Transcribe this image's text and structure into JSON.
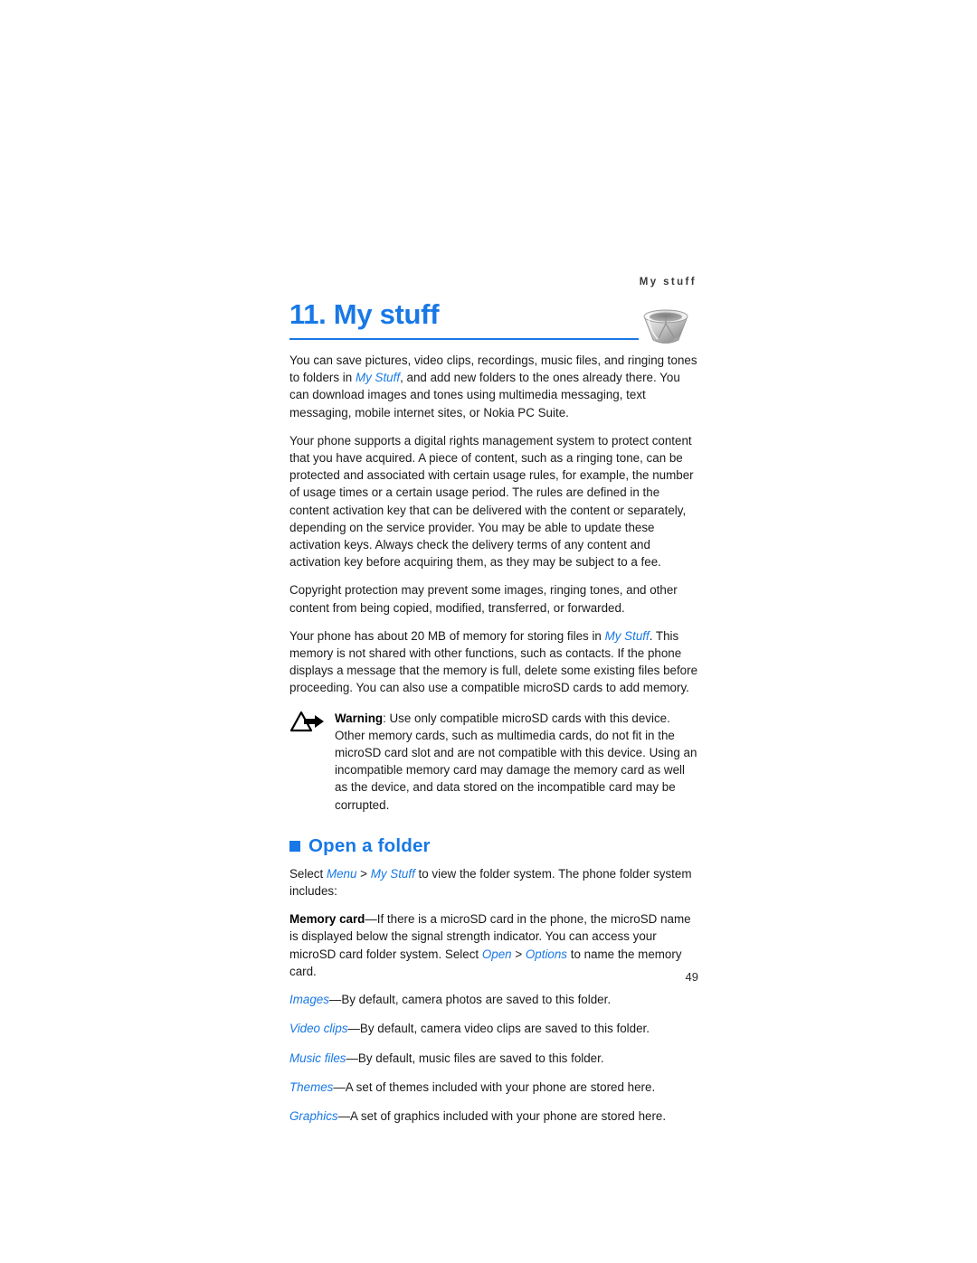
{
  "header": {
    "running_head": "My stuff",
    "page_number": "49"
  },
  "chapter": {
    "title": "11. My stuff",
    "icon_name": "bowl-icon",
    "accent_color": "#1878E6"
  },
  "intro": {
    "p1_part1": "You can save pictures, video clips, recordings, music files, and ringing tones to folders in ",
    "p1_ref": "My Stuff",
    "p1_part2": ", and add new folders to the ones already there. You can download images and tones using multimedia messaging, text messaging, mobile internet sites, or Nokia PC Suite.",
    "p2": "Your phone supports a digital rights management system to protect content that you have acquired. A piece of content, such as a ringing tone, can be protected and associated with certain usage rules, for example, the number of usage times or a certain usage period. The rules are defined in the content activation key that can be delivered with the content or separately, depending on the service provider. You may be able to update these activation keys. Always check the delivery terms of any content and activation key before acquiring them, as they may be subject to a fee.",
    "p3": "Copyright protection may prevent some images, ringing tones, and other content from being copied, modified, transferred, or forwarded.",
    "p4_part1": "Your phone has about 20 MB of memory for storing files in ",
    "p4_ref": "My Stuff",
    "p4_part2": ". This memory is not shared with other functions, such as contacts. If the phone displays a message that the memory is full, delete some existing files before proceeding. You can also use a compatible microSD cards to add memory."
  },
  "warning": {
    "icon_name": "warning-triangle-arrow-icon",
    "label": "Warning",
    "text": ": Use only compatible microSD cards with this device. Other memory cards, such as multimedia cards, do not fit in the microSD card slot and are not compatible with this device. Using an incompatible memory card may damage the memory card as well as the device, and data stored on the incompatible card may be corrupted."
  },
  "section": {
    "heading": "Open a folder",
    "intro_part1": "Select ",
    "intro_ref1": "Menu",
    "intro_sep": " > ",
    "intro_ref2": "My Stuff",
    "intro_part2": " to view the folder system. The phone folder system includes:",
    "memory_card_label": "Memory card",
    "memory_card_part1": "—If there is a microSD card in the phone, the microSD name is displayed below the signal strength indicator. You can access your microSD card folder system. Select ",
    "memory_card_ref1": "Open",
    "memory_card_sep": " > ",
    "memory_card_ref2": "Options",
    "memory_card_part2": " to name the memory card."
  },
  "folders": [
    {
      "name": "Images",
      "description": "—By default, camera photos are saved to this folder."
    },
    {
      "name": "Video clips",
      "description": "—By default, camera video clips are saved to this folder."
    },
    {
      "name": "Music files",
      "description": "—By default, music files are saved to this folder."
    },
    {
      "name": "Themes",
      "description": "—A set of themes included with your phone are stored here."
    },
    {
      "name": "Graphics",
      "description": "—A set of graphics included with your phone are stored here."
    }
  ]
}
